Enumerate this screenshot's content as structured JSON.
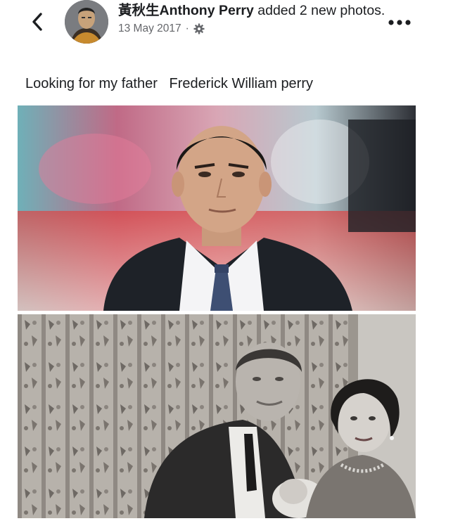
{
  "post": {
    "author_name": "黃秋生Anthony Perry",
    "action_text": " added 2 new photos.",
    "date": "13 May 2017",
    "separator": "·",
    "privacy_icon": "gear-icon",
    "caption": "Looking for my father   Frederick William perry"
  },
  "icons": {
    "back": "chevron-left-icon",
    "more": "more-dots-icon"
  },
  "photos": [
    {
      "name": "color-portrait"
    },
    {
      "name": "vintage-family-photo"
    }
  ]
}
